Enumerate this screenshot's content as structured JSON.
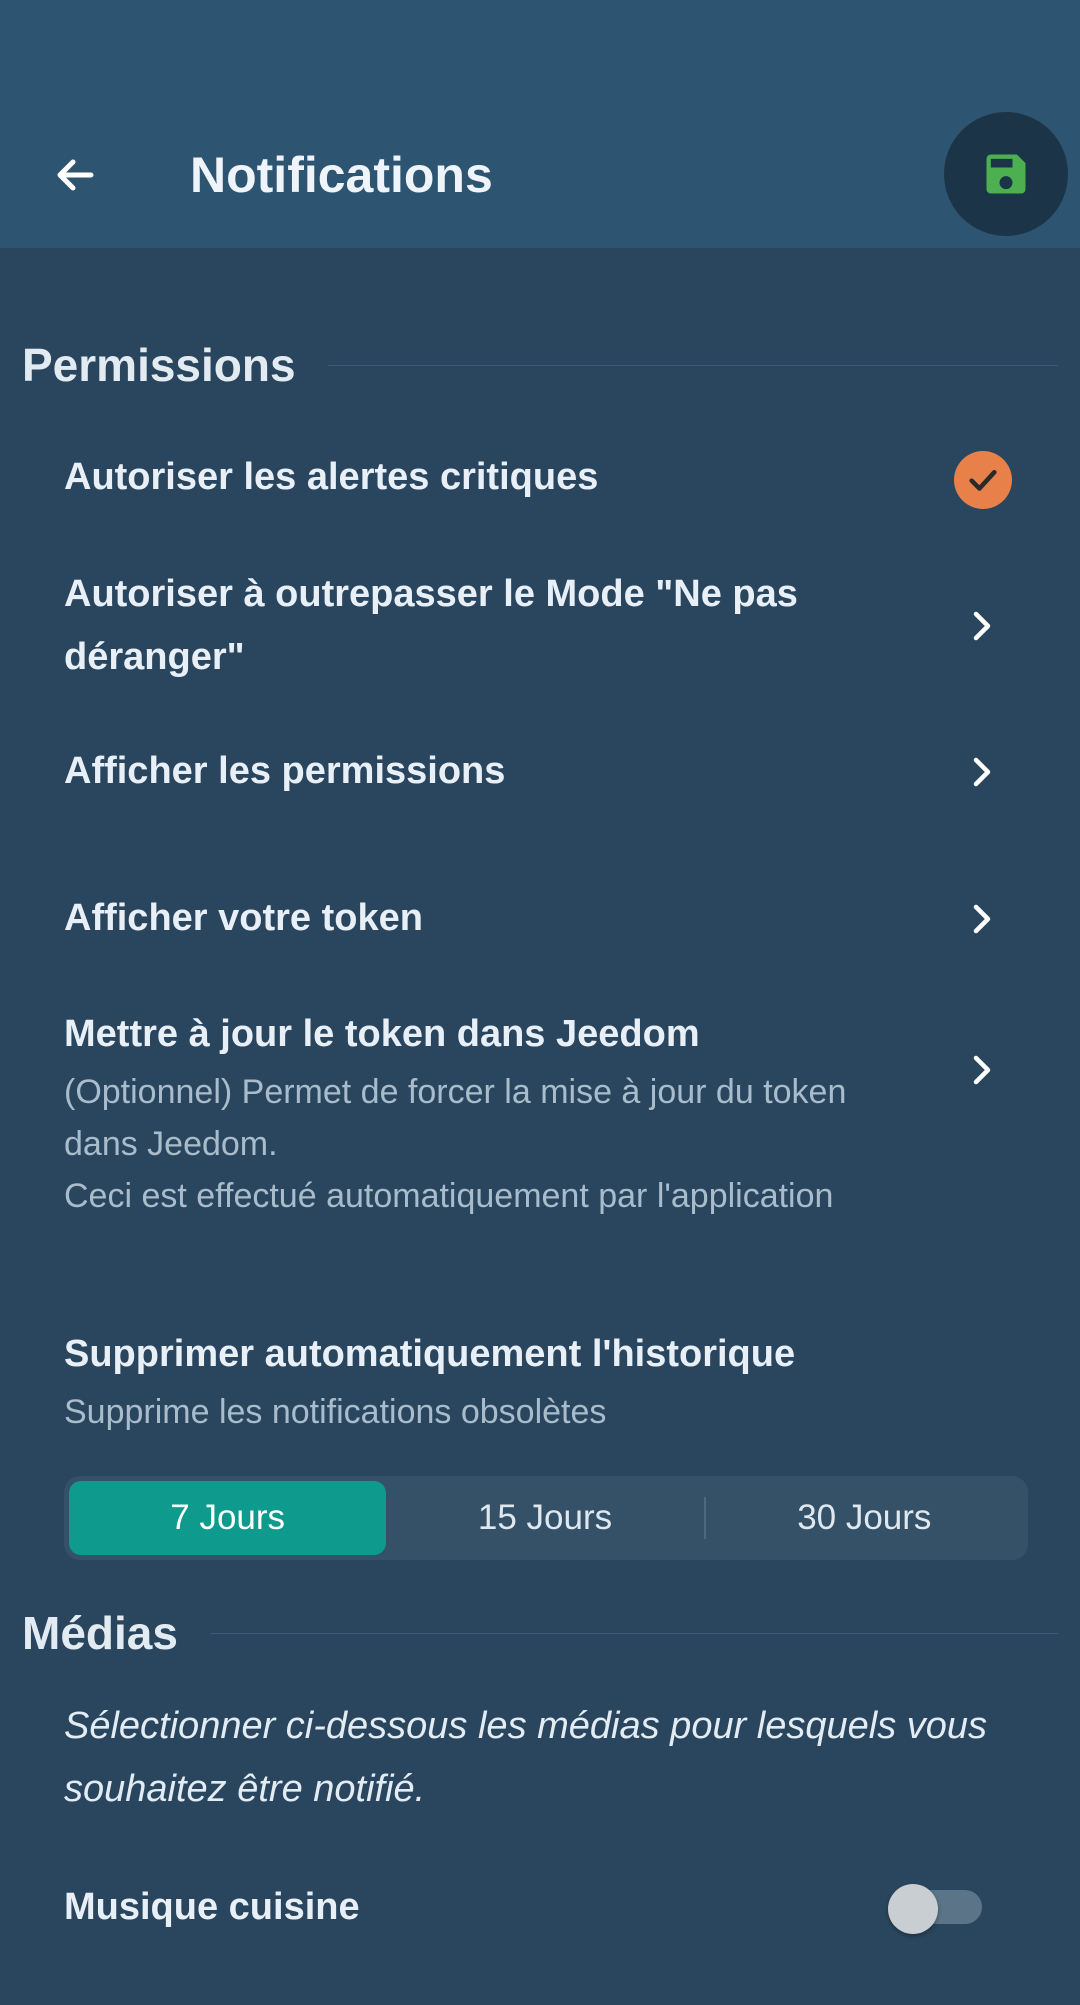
{
  "appbar": {
    "title": "Notifications",
    "back_icon": "arrow-left-icon",
    "save_icon": "floppy-disk-icon"
  },
  "permissions": {
    "header": "Permissions",
    "items": [
      {
        "title": "Autoriser les alertes critiques",
        "trailing": "check-circle-icon"
      },
      {
        "title": "Autoriser à outrepasser le Mode \"Ne pas déranger\"",
        "trailing": "chevron-right-icon"
      },
      {
        "title": "Afficher les permissions",
        "trailing": "chevron-right-icon"
      },
      {
        "title": "Afficher votre token",
        "trailing": "chevron-right-icon"
      },
      {
        "title": "Mettre à jour le token dans Jeedom",
        "subtitle_1": "(Optionnel) Permet de forcer la mise à jour du token dans Jeedom.",
        "subtitle_2": "Ceci est effectué automatiquement par l'application",
        "trailing": "chevron-right-icon"
      }
    ],
    "history": {
      "title": "Supprimer automatiquement l'historique",
      "subtitle": "Supprime les notifications obsolètes",
      "options": [
        "7 Jours",
        "15 Jours",
        "30 Jours"
      ],
      "selected": "7 Jours"
    }
  },
  "medias": {
    "header": "Médias",
    "note": "Sélectionner ci-dessous les médias pour lesquels vous souhaitez être notifié.",
    "items": [
      {
        "label": "Musique cuisine",
        "enabled": false
      }
    ]
  },
  "colors": {
    "background": "#2a465e",
    "appbar": "#2d5470",
    "accent_teal": "#0e9a8c",
    "check_orange": "#e8804a",
    "save_green": "#4caf50"
  }
}
